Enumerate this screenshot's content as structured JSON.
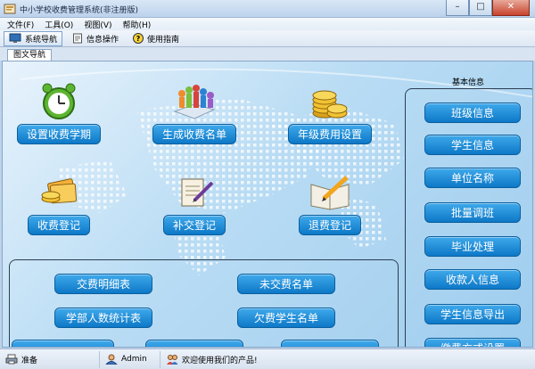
{
  "window": {
    "title": "中小学校收费管理系统(非注册版)",
    "minimize": "–",
    "maximize": "□",
    "close": "✕"
  },
  "menu": [
    "文件(F)",
    "工具(O)",
    "视图(V)",
    "帮助(H)"
  ],
  "toolbar": {
    "nav": "系统导航",
    "info": "信息操作",
    "help": "使用指南"
  },
  "tab": "图文导航",
  "features": {
    "set_term": "设置收费学期",
    "gen_list": "生成收费名单",
    "grade_fee": "年级费用设置",
    "register": "收费登记",
    "supplement": "补交登记",
    "refund": "退费登记"
  },
  "reports": {
    "detail": "交费明细表",
    "unpaid_list": "未交费名单",
    "dept_stats": "学部人数统计表",
    "owing_list": "欠费学生名单"
  },
  "basic_info": {
    "title": "基本信息",
    "items": [
      "班级信息",
      "学生信息",
      "单位名称",
      "批量调班",
      "毕业处理",
      "收款人信息",
      "学生信息导出",
      "缴费方式设置"
    ]
  },
  "status": {
    "ready": "准备",
    "user": "Admin",
    "welcome": "欢迎使用我们的产品!"
  },
  "colors": {
    "button_top": "#3fa9eb",
    "button_bottom": "#0d78c7",
    "background": "#9fcdee"
  }
}
